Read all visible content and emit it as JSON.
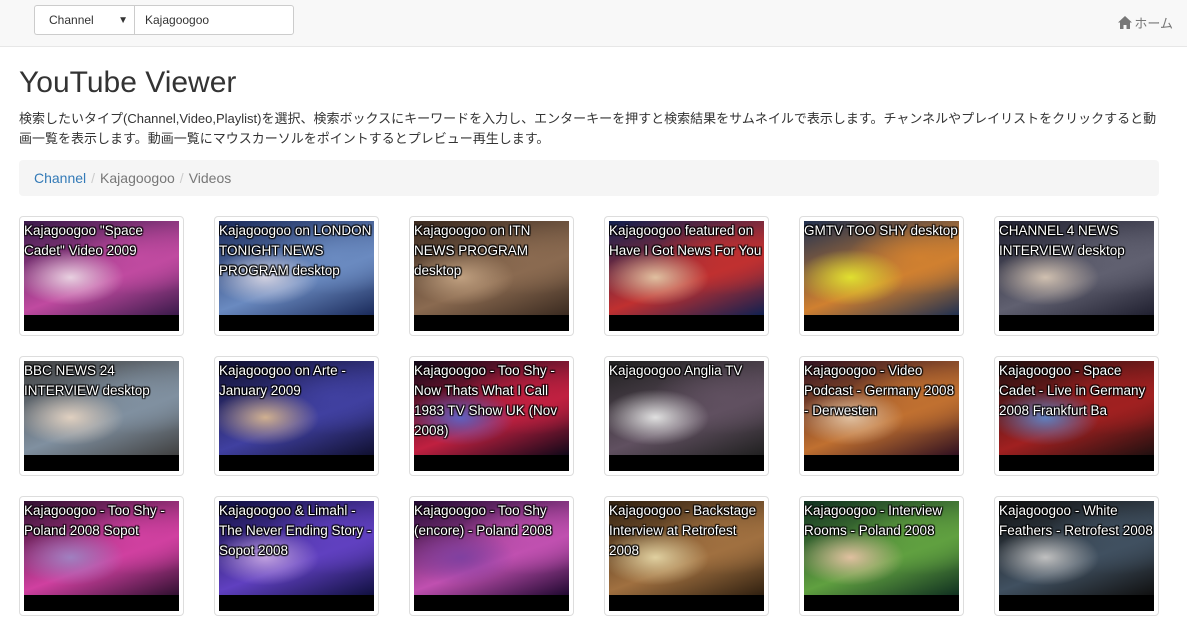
{
  "nav": {
    "type_select": "Channel",
    "search_value": "Kajagoogoo",
    "home_label": "ホーム"
  },
  "page": {
    "title": "YouTube Viewer",
    "description": "検索したいタイプ(Channel,Video,Playlist)を選択、検索ボックスにキーワードを入力し、エンターキーを押すと検索結果をサムネイルで表示します。チャンネルやプレイリストをクリックすると動画一覧を表示します。動画一覧にマウスカーソルをポイントするとプレビュー再生します。"
  },
  "breadcrumb": {
    "items": [
      "Channel",
      "Kajagoogoo",
      "Videos"
    ]
  },
  "videos": [
    {
      "title": "Kajagoogoo \"Space Cadet\" Video 2009"
    },
    {
      "title": "Kajagoogoo on LONDON TONIGHT NEWS PROGRAM desktop"
    },
    {
      "title": "Kajagoogoo on ITN NEWS PROGRAM desktop"
    },
    {
      "title": "Kajagoogoo featured on Have I Got News For You"
    },
    {
      "title": "GMTV TOO SHY desktop"
    },
    {
      "title": "CHANNEL 4 NEWS INTERVIEW desktop"
    },
    {
      "title": "BBC NEWS 24 INTERVIEW desktop"
    },
    {
      "title": "Kajagoogoo on Arte - January 2009"
    },
    {
      "title": "Kajagoogoo - Too Shy - Now Thats What I Call 1983 TV Show UK (Nov 2008)"
    },
    {
      "title": "Kajagoogoo Anglia TV"
    },
    {
      "title": "Kajagoogoo - Video Podcast - Germany 2008 - Derwesten"
    },
    {
      "title": "Kajagoogoo - Space Cadet - Live in Germany 2008 Frankfurt Ba"
    },
    {
      "title": "Kajagoogoo - Too Shy - Poland 2008 Sopot"
    },
    {
      "title": "Kajagoogoo & Limahl - The Never Ending Story - Sopot 2008"
    },
    {
      "title": "Kajagoogoo - Too Shy (encore) - Poland 2008"
    },
    {
      "title": "Kajagoogoo - Backstage Interview at Retrofest 2008"
    },
    {
      "title": "Kajagoogoo - Interview Rooms - Poland 2008"
    },
    {
      "title": "Kajagoogoo - White Feathers - Retrofest 2008"
    }
  ]
}
